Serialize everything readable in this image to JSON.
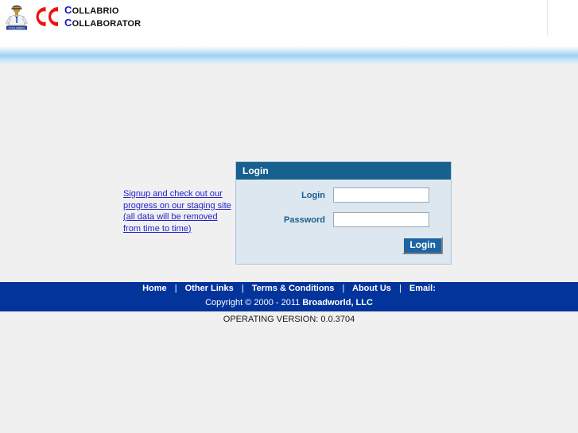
{
  "header": {
    "mascot_icon": "person-mascot-icon",
    "rings_icon": "interlocking-cc-rings-icon",
    "brand_line1_cap": "C",
    "brand_line1_rest": "OLLABRIO",
    "brand_line2_cap": "C",
    "brand_line2_rest": "OLLABORATOR"
  },
  "main": {
    "signup_link": "Signup and check out our progress on our staging site (all data will be removed from time to time)",
    "login_panel": {
      "title": "Login",
      "login_label": "Login",
      "login_value": "",
      "login_placeholder": "",
      "password_label": "Password",
      "password_value": "",
      "password_placeholder": "",
      "submit_label": "Login"
    }
  },
  "footer": {
    "links": [
      {
        "label": "Home"
      },
      {
        "label": "Other Links"
      },
      {
        "label": "Terms & Conditions"
      },
      {
        "label": "About Us"
      },
      {
        "label": "Email:"
      }
    ],
    "separator": "|",
    "copyright_prefix": "Copyright © 2000 - 2011 ",
    "copyright_company": "Broadworld, LLC",
    "version": "OPERATING VERSION: 0.0.3704"
  },
  "colors": {
    "page_background": "#f0f0f0",
    "band_blue": "#9fd0f2",
    "panel_header": "#17608f",
    "panel_body": "#dce7f0",
    "footer_blue": "#03349c",
    "link_blue": "#2222cc",
    "logo_red": "#ee1111",
    "logo_blue": "#1516c8"
  }
}
